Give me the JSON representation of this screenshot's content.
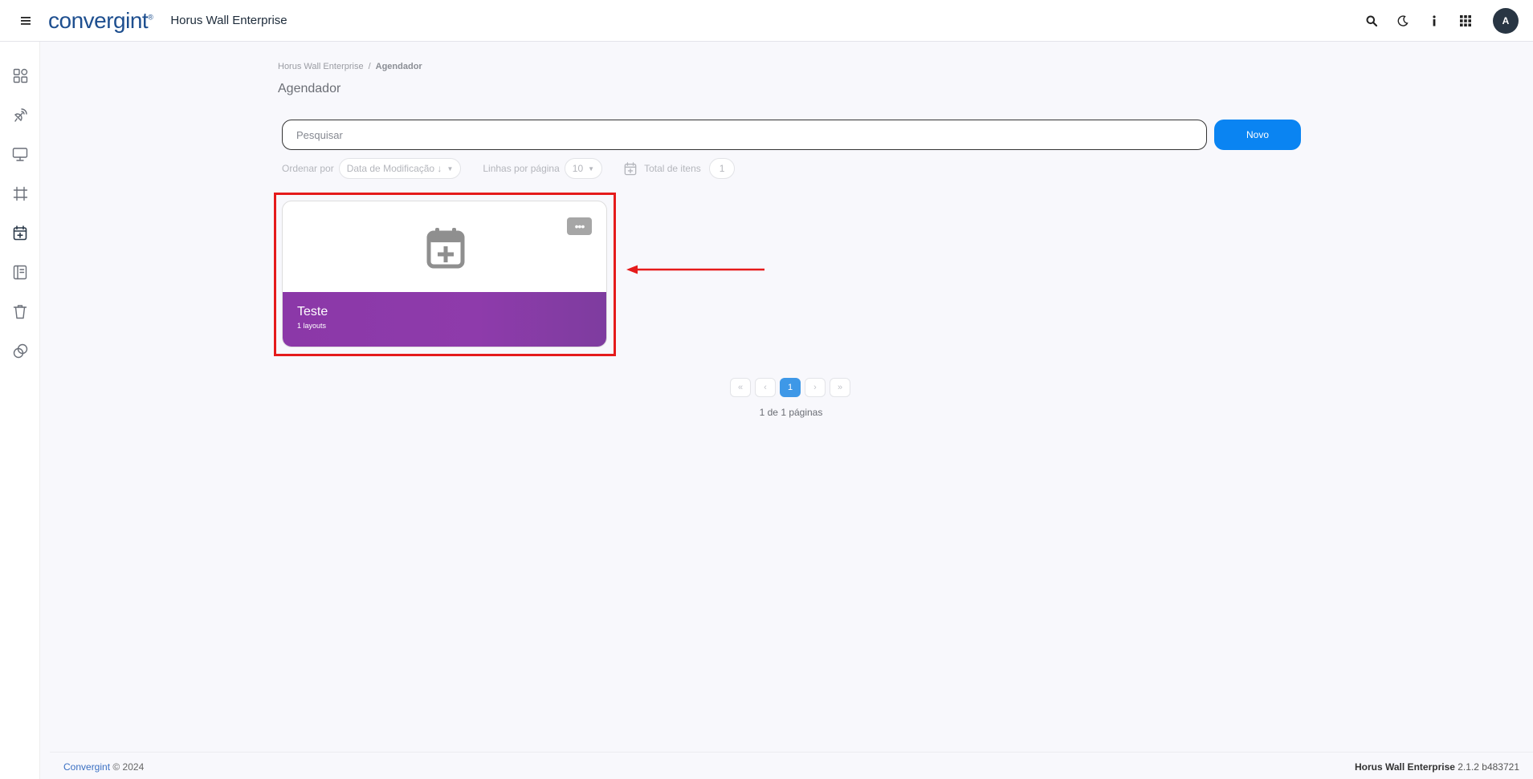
{
  "header": {
    "logo_text": "convergint",
    "logo_mark": "®",
    "app_title": "Horus Wall Enterprise",
    "avatar_initial": "A",
    "icons": [
      "search-icon",
      "moon-icon",
      "info-icon",
      "apps-grid-icon"
    ]
  },
  "sidebar": {
    "items": [
      "dashboard-icon",
      "satellite-icon",
      "monitor-icon",
      "frame-icon",
      "calendar-plus-icon",
      "book-icon",
      "trash-icon",
      "link-icon"
    ],
    "active_index": 4
  },
  "breadcrumb": {
    "root": "Horus Wall Enterprise",
    "separator": "/",
    "current": "Agendador"
  },
  "page_title": "Agendador",
  "search": {
    "placeholder": "Pesquisar",
    "value": ""
  },
  "new_button": "Novo",
  "filters": {
    "sort_label": "Ordenar por",
    "sort_value": "Data de Modificação ↓",
    "rows_label": "Linhas por página",
    "rows_value": "10",
    "total_label": "Total de itens",
    "total_value": "1"
  },
  "cards": [
    {
      "title": "Teste",
      "subtitle": "1 layouts",
      "menu": "•••"
    }
  ],
  "pagination": {
    "first": "«",
    "prev": "‹",
    "current": "1",
    "next": "›",
    "last": "»",
    "info": "1 de 1 páginas"
  },
  "footer": {
    "brand": "Convergint",
    "copyright": " © 2024",
    "product": "Horus Wall Enterprise",
    "version": " 2.1.2 b483721"
  },
  "colors": {
    "accent": "#0a84f2",
    "card_gradient": "#8b38a8",
    "highlight": "#e51b1b",
    "pager_active": "#3e98e7"
  }
}
